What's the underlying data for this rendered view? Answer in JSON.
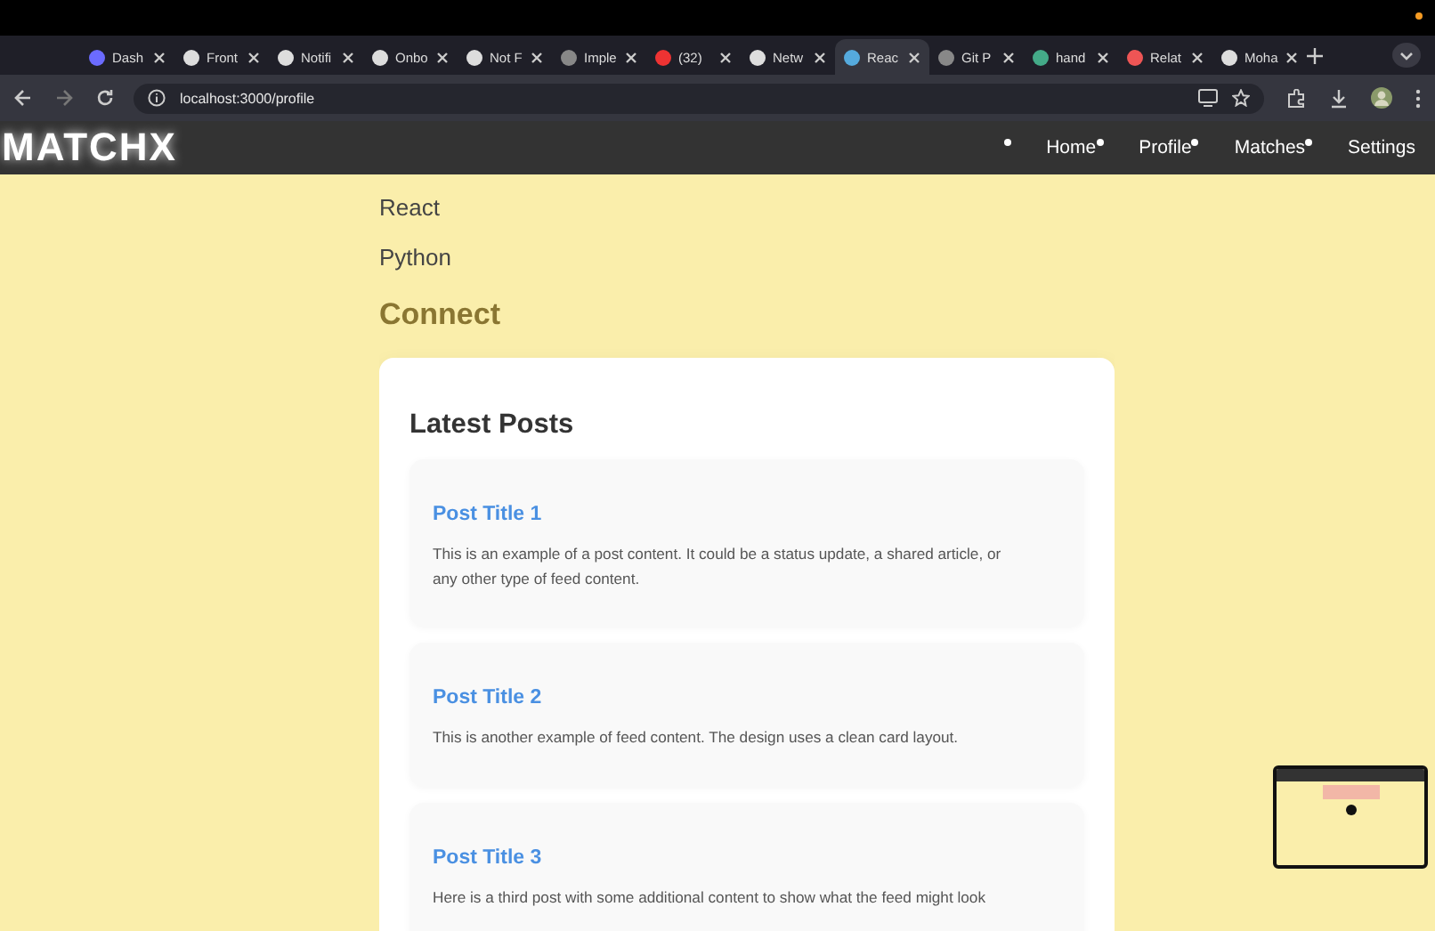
{
  "browser": {
    "tabs": [
      {
        "label": "Dash",
        "selected": false
      },
      {
        "label": "Front",
        "selected": false
      },
      {
        "label": "Notifi",
        "selected": false
      },
      {
        "label": "Onbo",
        "selected": false
      },
      {
        "label": "Not F",
        "selected": false
      },
      {
        "label": "Imple",
        "selected": false
      },
      {
        "label": "(32)",
        "selected": false
      },
      {
        "label": "Netw",
        "selected": false
      },
      {
        "label": "Reac",
        "selected": true
      },
      {
        "label": "Git P",
        "selected": false
      },
      {
        "label": "hand",
        "selected": false
      },
      {
        "label": "Relat",
        "selected": false
      },
      {
        "label": "Moha",
        "selected": false
      }
    ],
    "address": "localhost:3000/profile"
  },
  "navbar": {
    "logo": "MATCHX",
    "links": [
      "Home",
      "Profile",
      "Matches",
      "Settings"
    ]
  },
  "skills": [
    "React",
    "Python"
  ],
  "connect_heading": "Connect",
  "feed": {
    "title": "Latest Posts",
    "posts": [
      {
        "title": "Post Title 1",
        "body": "This is an example of a post content. It could be a status update, a shared article, or any other type of feed content."
      },
      {
        "title": "Post Title 2",
        "body": "This is another example of feed content. The design uses a clean card layout."
      },
      {
        "title": "Post Title 3",
        "body": "Here is a third post with some additional content to show what the feed might look"
      }
    ]
  }
}
